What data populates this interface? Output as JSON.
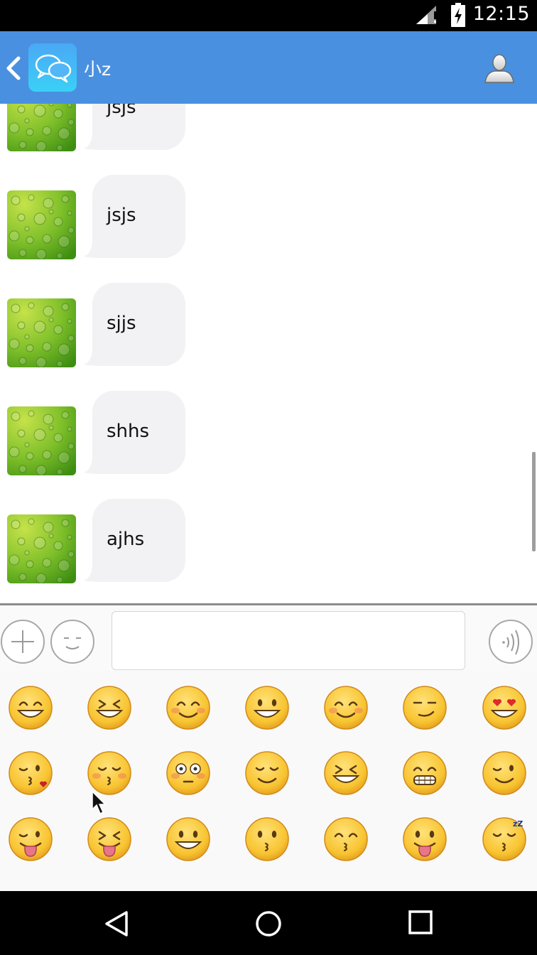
{
  "status_bar": {
    "time": "12:15"
  },
  "header": {
    "title": "小z"
  },
  "messages": [
    {
      "text": "jsjs"
    },
    {
      "text": "jsjs"
    },
    {
      "text": "sjjs"
    },
    {
      "text": "shhs"
    },
    {
      "text": "ajhs"
    }
  ],
  "input": {
    "placeholder": "",
    "value": ""
  },
  "emoji_rows": [
    [
      "grinning-face",
      "laughing-face",
      "smiling-face",
      "smiley-face",
      "blushing-face",
      "smirking-face",
      "heart-eyes-face"
    ],
    [
      "kissing-heart-face",
      "kissing-closed-eyes-face",
      "flushed-face",
      "relieved-face",
      "laughing-squint-face",
      "grimacing-face",
      "winking-face"
    ],
    [
      "winking-tongue-face",
      "squinting-tongue-face",
      "grinning-big-face",
      "kissing-face",
      "kissing-smiling-eyes-face",
      "tongue-face",
      "sleeping-face"
    ]
  ],
  "colors": {
    "app_bar": "#4a90e0",
    "bubble": "#f2f2f4",
    "emoji_face": "#f6c432"
  }
}
